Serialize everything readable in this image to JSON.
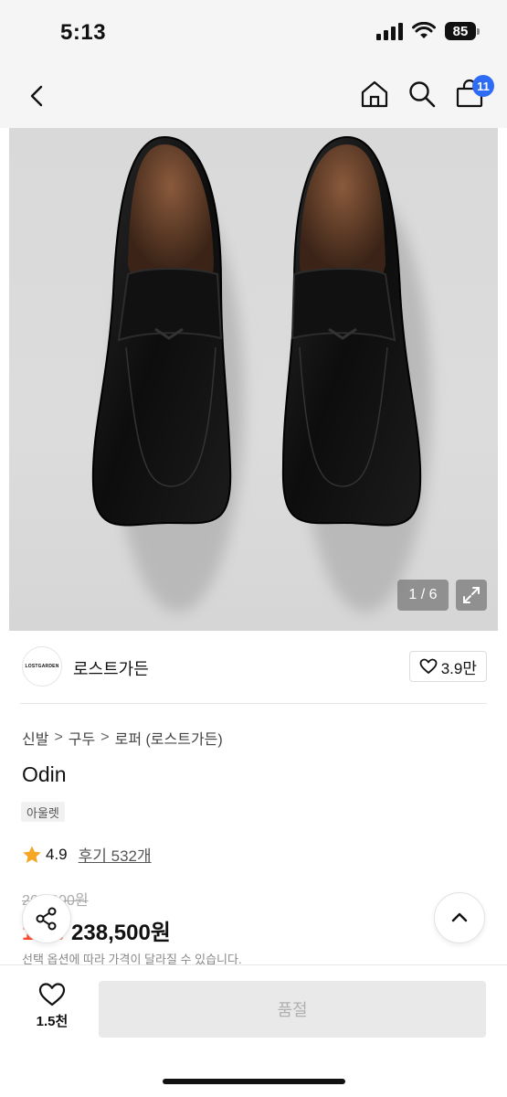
{
  "status_bar": {
    "time": "5:13",
    "battery": "85"
  },
  "header": {
    "cart_count": "11"
  },
  "gallery": {
    "counter": "1 / 6"
  },
  "brand": {
    "logo_text": "LOSTGARDEN",
    "name": "로스트가든",
    "likes": "3.9만"
  },
  "breadcrumb": {
    "items": [
      "신발",
      "구두",
      "로퍼 (로스트가든)"
    ],
    "separator": ">"
  },
  "product": {
    "title": "Odin",
    "tag": "아울렛",
    "rating": "4.9",
    "reviews": "후기 532개",
    "original_price": "265,000원",
    "discount": "10%",
    "price": "238,500원",
    "price_note": "선택 옵션에 따라 가격이 달라질 수 있습니다."
  },
  "bottom": {
    "wish_count": "1.5천",
    "buy_label": "품절"
  },
  "colors": {
    "accent": "#2f6cf6",
    "discount": "#ff4a2a",
    "star": "#f5a623"
  }
}
